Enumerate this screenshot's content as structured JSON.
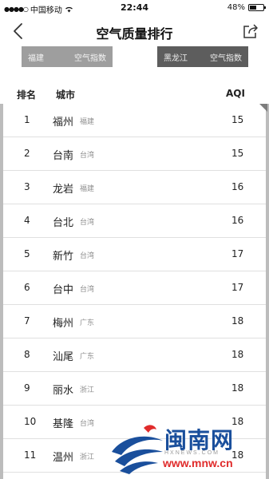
{
  "status_bar": {
    "signal": "●●●●○",
    "carrier": "中国移动",
    "time": "22:44",
    "battery_text": "48%",
    "battery_level": 0.48
  },
  "nav": {
    "title": "空气质量排行"
  },
  "tabs": [
    {
      "region": "福建",
      "label": "空气指数"
    },
    {
      "region": "黑龙江",
      "label": "空气指数"
    }
  ],
  "table": {
    "headers": {
      "rank": "排名",
      "city": "城市",
      "aqi": "AQI"
    },
    "rows": [
      {
        "rank": "1",
        "city": "福州",
        "province": "福建",
        "aqi": "15"
      },
      {
        "rank": "2",
        "city": "台南",
        "province": "台湾",
        "aqi": "15"
      },
      {
        "rank": "3",
        "city": "龙岩",
        "province": "福建",
        "aqi": "16"
      },
      {
        "rank": "4",
        "city": "台北",
        "province": "台湾",
        "aqi": "16"
      },
      {
        "rank": "5",
        "city": "新竹",
        "province": "台湾",
        "aqi": "17"
      },
      {
        "rank": "6",
        "city": "台中",
        "province": "台湾",
        "aqi": "17"
      },
      {
        "rank": "7",
        "city": "梅州",
        "province": "广东",
        "aqi": "18"
      },
      {
        "rank": "8",
        "city": "汕尾",
        "province": "广东",
        "aqi": "18"
      },
      {
        "rank": "9",
        "city": "丽水",
        "province": "浙江",
        "aqi": "18"
      },
      {
        "rank": "10",
        "city": "基隆",
        "province": "台湾",
        "aqi": "18"
      },
      {
        "rank": "11",
        "city": "温州",
        "province": "浙江",
        "aqi": "18"
      }
    ]
  },
  "watermark": {
    "name": "闽南网",
    "sub": "HXNEWS.COM",
    "url": "www.mnw.cn"
  },
  "colors": {
    "tab_left_bg": "#9e9e9e",
    "tab_right_bg": "#5d5d5d",
    "watermark_blue": "#1a4f9c",
    "watermark_red": "#e02b2b"
  }
}
